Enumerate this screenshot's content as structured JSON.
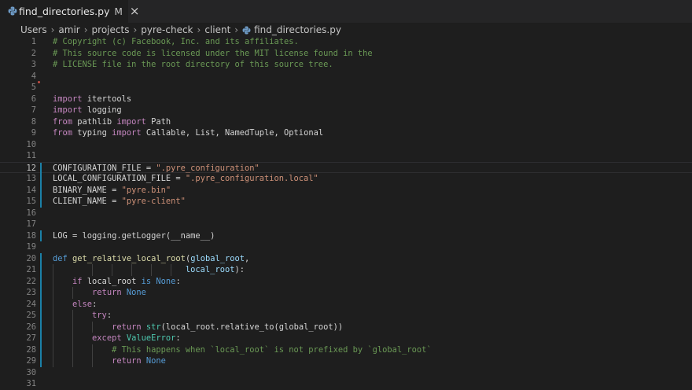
{
  "tab": {
    "label": "find_directories.py",
    "modified": "M",
    "close": "×"
  },
  "breadcrumb": [
    "Users",
    "amir",
    "projects",
    "pyre-check",
    "client",
    "find_directories.py"
  ],
  "editor": {
    "active_line": 12,
    "lines": [
      {
        "n": "1",
        "t": [
          [
            "c-com",
            "# Copyright (c) Facebook, Inc. and its affiliates."
          ]
        ]
      },
      {
        "n": "2",
        "t": [
          [
            "c-com",
            "# This source code is licensed under the MIT license found in the"
          ]
        ]
      },
      {
        "n": "3",
        "t": [
          [
            "c-com",
            "# LICENSE file in the root directory of this source tree."
          ]
        ]
      },
      {
        "n": "4",
        "t": []
      },
      {
        "n": "5",
        "t": []
      },
      {
        "n": "6",
        "t": [
          [
            "c-kw",
            "import"
          ],
          [
            "c-plain",
            " itertools"
          ]
        ]
      },
      {
        "n": "7",
        "t": [
          [
            "c-kw",
            "import"
          ],
          [
            "c-plain",
            " logging"
          ]
        ]
      },
      {
        "n": "8",
        "t": [
          [
            "c-kw",
            "from"
          ],
          [
            "c-plain",
            " pathlib "
          ],
          [
            "c-kw",
            "import"
          ],
          [
            "c-plain",
            " Path"
          ]
        ]
      },
      {
        "n": "9",
        "t": [
          [
            "c-kw",
            "from"
          ],
          [
            "c-plain",
            " typing "
          ],
          [
            "c-kw",
            "import"
          ],
          [
            "c-plain",
            " Callable, List, NamedTuple, Optional"
          ]
        ]
      },
      {
        "n": "10",
        "t": []
      },
      {
        "n": "11",
        "t": []
      },
      {
        "n": "12",
        "t": [
          [
            "c-plain",
            "CONFIGURATION_FILE = "
          ],
          [
            "c-str",
            "\".pyre_configuration\""
          ]
        ]
      },
      {
        "n": "13",
        "t": [
          [
            "c-plain",
            "LOCAL_CONFIGURATION_FILE = "
          ],
          [
            "c-str",
            "\".pyre_configuration.local\""
          ]
        ]
      },
      {
        "n": "14",
        "t": [
          [
            "c-plain",
            "BINARY_NAME = "
          ],
          [
            "c-str",
            "\"pyre.bin\""
          ]
        ]
      },
      {
        "n": "15",
        "t": [
          [
            "c-plain",
            "CLIENT_NAME = "
          ],
          [
            "c-str",
            "\"pyre-client\""
          ]
        ]
      },
      {
        "n": "16",
        "t": []
      },
      {
        "n": "17",
        "t": []
      },
      {
        "n": "18",
        "t": [
          [
            "c-plain",
            "LOG = logging.getLogger(__name__)"
          ]
        ]
      },
      {
        "n": "19",
        "t": []
      },
      {
        "n": "20",
        "t": [
          [
            "c-def",
            "def"
          ],
          [
            "c-plain",
            " "
          ],
          [
            "c-fn",
            "get_relative_local_root"
          ],
          [
            "c-plain",
            "("
          ],
          [
            "c-var",
            "global_root"
          ],
          [
            "c-plain",
            ","
          ]
        ]
      },
      {
        "n": "21",
        "t": [
          [
            "c-plain",
            "                           "
          ],
          [
            "c-var",
            "local_root"
          ],
          [
            "c-plain",
            "):"
          ]
        ]
      },
      {
        "n": "22",
        "t": [
          [
            "c-plain",
            "    "
          ],
          [
            "c-kw",
            "if"
          ],
          [
            "c-plain",
            " local_root "
          ],
          [
            "c-def",
            "is"
          ],
          [
            "c-plain",
            " "
          ],
          [
            "c-def",
            "None"
          ],
          [
            "c-plain",
            ":"
          ]
        ]
      },
      {
        "n": "23",
        "t": [
          [
            "c-plain",
            "        "
          ],
          [
            "c-kw",
            "return"
          ],
          [
            "c-plain",
            " "
          ],
          [
            "c-def",
            "None"
          ]
        ]
      },
      {
        "n": "24",
        "t": [
          [
            "c-plain",
            "    "
          ],
          [
            "c-kw",
            "else"
          ],
          [
            "c-plain",
            ":"
          ]
        ]
      },
      {
        "n": "25",
        "t": [
          [
            "c-plain",
            "        "
          ],
          [
            "c-kw",
            "try"
          ],
          [
            "c-plain",
            ":"
          ]
        ]
      },
      {
        "n": "26",
        "t": [
          [
            "c-plain",
            "            "
          ],
          [
            "c-kw",
            "return"
          ],
          [
            "c-plain",
            " "
          ],
          [
            "c-cls",
            "str"
          ],
          [
            "c-plain",
            "(local_root.relative_to(global_root))"
          ]
        ]
      },
      {
        "n": "27",
        "t": [
          [
            "c-plain",
            "        "
          ],
          [
            "c-kw",
            "except"
          ],
          [
            "c-plain",
            " "
          ],
          [
            "c-cls",
            "ValueError"
          ],
          [
            "c-plain",
            ":"
          ]
        ]
      },
      {
        "n": "28",
        "t": [
          [
            "c-plain",
            "            "
          ],
          [
            "c-com",
            "# This happens when `local_root` is not prefixed by `global_root`"
          ]
        ]
      },
      {
        "n": "29",
        "t": [
          [
            "c-plain",
            "            "
          ],
          [
            "c-kw",
            "return"
          ],
          [
            "c-plain",
            " "
          ],
          [
            "c-def",
            "None"
          ]
        ]
      },
      {
        "n": "30",
        "t": []
      },
      {
        "n": "31",
        "t": []
      }
    ]
  },
  "icons": {
    "file_icon": "python-file-icon",
    "file_icon_color": "#6e9bc6"
  },
  "colors": {
    "background": "#1e1e1e",
    "tabbar": "#252526",
    "gutter_change": "#1b81a8"
  }
}
